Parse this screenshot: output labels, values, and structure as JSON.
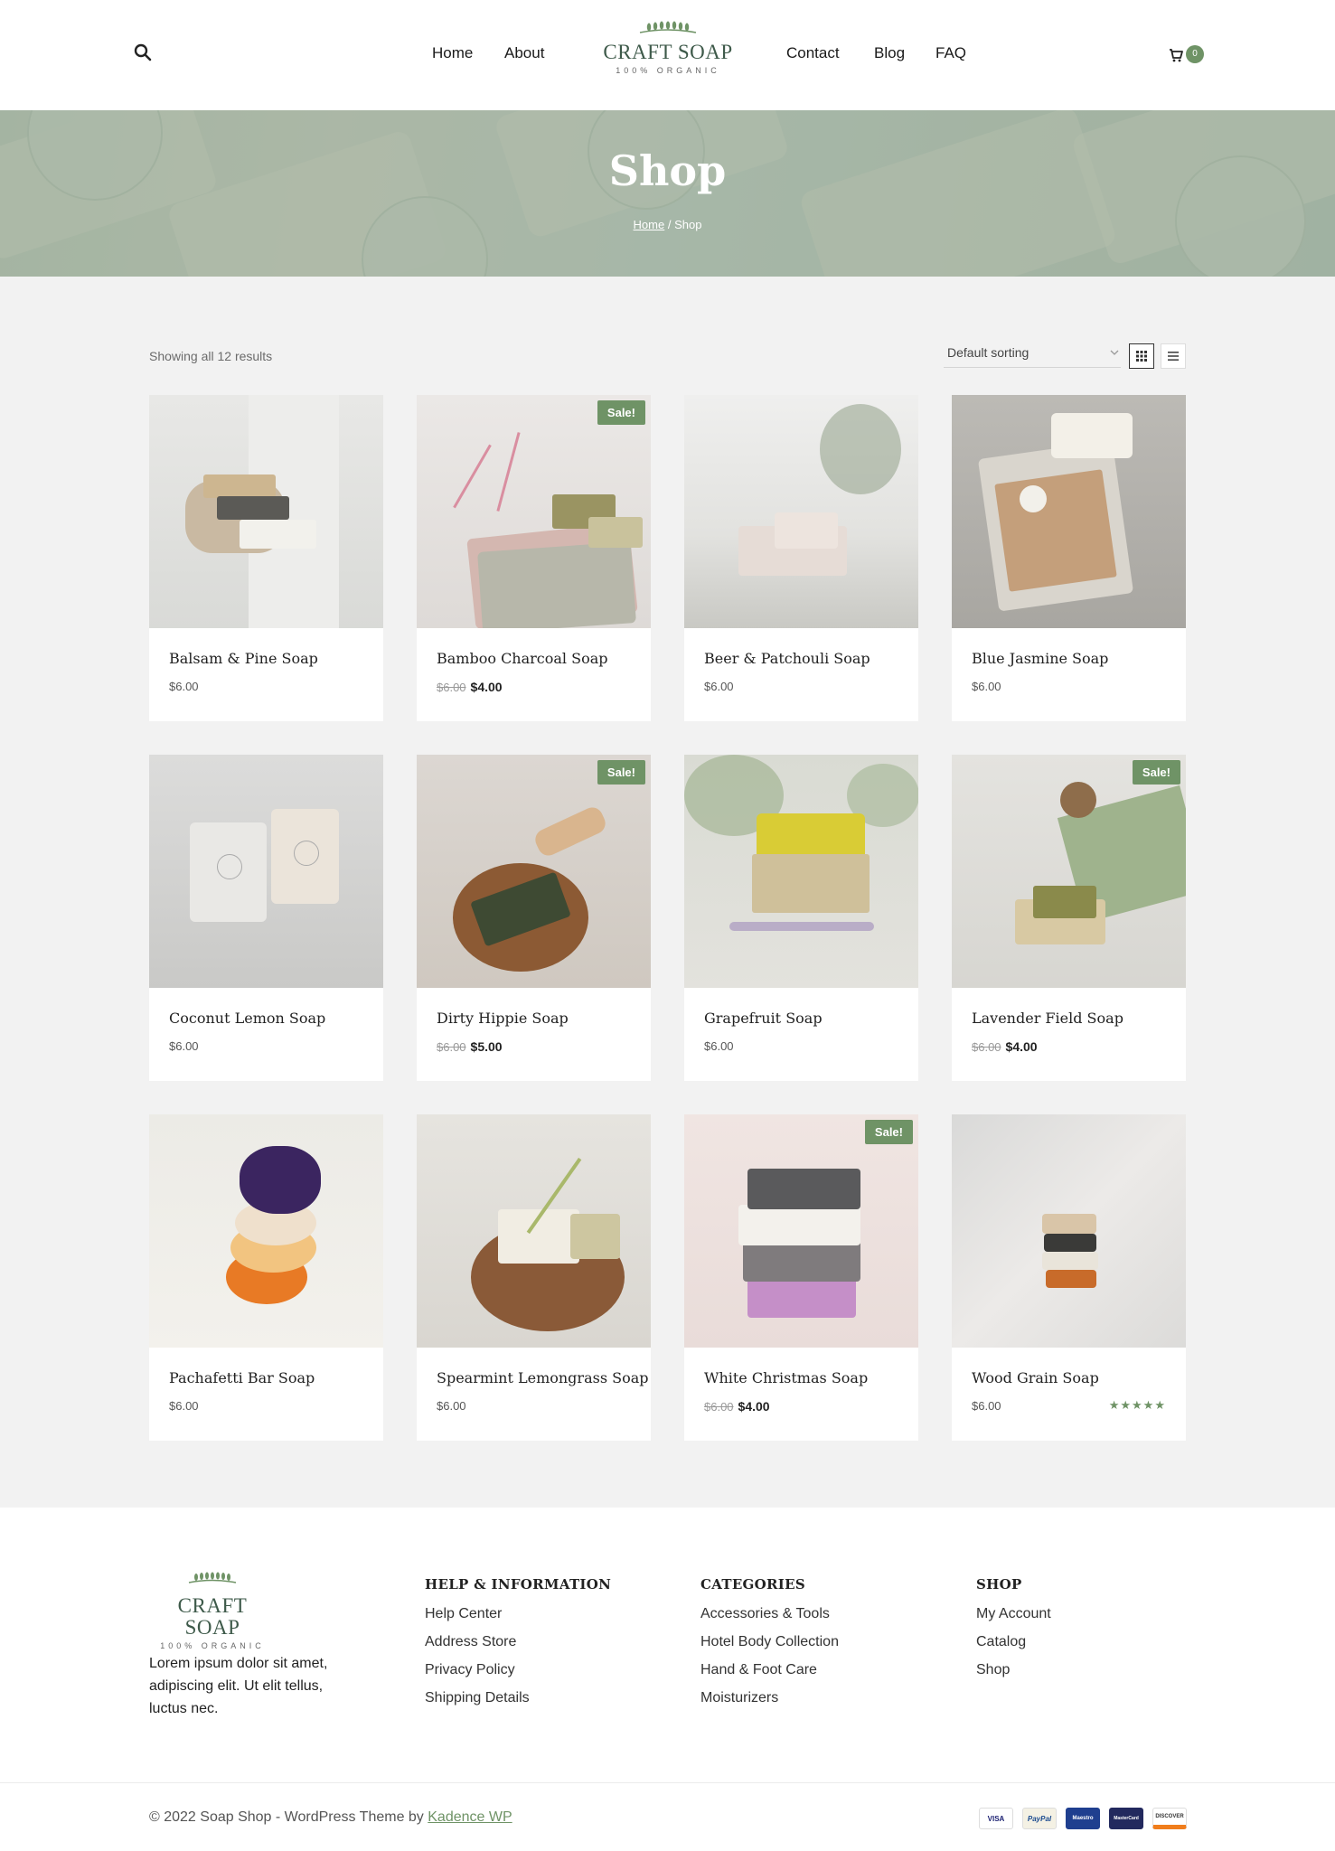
{
  "header": {
    "nav_left": [
      "Home",
      "About"
    ],
    "nav_right": [
      "Contact",
      "Blog",
      "FAQ"
    ],
    "logo_title": "CRAFT SOAP",
    "logo_subtitle": "100% ORGANIC",
    "cart_count": "0"
  },
  "hero": {
    "title": "Shop",
    "breadcrumb_home": "Home",
    "breadcrumb_separator": " / ",
    "breadcrumb_current": "Shop"
  },
  "toolbar": {
    "result_count": "Showing all 12 results",
    "sort_selected": "Default sorting"
  },
  "sale_label": "Sale!",
  "products": [
    {
      "name": "Balsam & Pine Soap",
      "price": "$6.00",
      "old_price": "",
      "sale_price": ""
    },
    {
      "name": "Bamboo Charcoal Soap",
      "price": "",
      "old_price": "$6.00",
      "sale_price": "$4.00"
    },
    {
      "name": "Beer & Patchouli Soap",
      "price": "$6.00",
      "old_price": "",
      "sale_price": ""
    },
    {
      "name": "Blue Jasmine Soap",
      "price": "$6.00",
      "old_price": "",
      "sale_price": ""
    },
    {
      "name": "Coconut Lemon Soap",
      "price": "$6.00",
      "old_price": "",
      "sale_price": ""
    },
    {
      "name": "Dirty Hippie Soap",
      "price": "",
      "old_price": "$6.00",
      "sale_price": "$5.00"
    },
    {
      "name": "Grapefruit Soap",
      "price": "$6.00",
      "old_price": "",
      "sale_price": ""
    },
    {
      "name": "Lavender Field Soap",
      "price": "",
      "old_price": "$6.00",
      "sale_price": "$4.00"
    },
    {
      "name": "Pachafetti Bar Soap",
      "price": "$6.00",
      "old_price": "",
      "sale_price": ""
    },
    {
      "name": "Spearmint Lemongrass Soap",
      "price": "$6.00",
      "old_price": "",
      "sale_price": ""
    },
    {
      "name": "White Christmas Soap",
      "price": "",
      "old_price": "$6.00",
      "sale_price": "$4.00"
    },
    {
      "name": "Wood Grain Soap",
      "price": "$6.00",
      "old_price": "",
      "sale_price": "",
      "rating": 5,
      "rating_stars": "★★★★★"
    }
  ],
  "footer": {
    "logo_title": "CRAFT SOAP",
    "logo_subtitle": "100% ORGANIC",
    "about": "Lorem ipsum dolor sit amet, adipiscing elit. Ut elit tellus, luctus nec.",
    "columns": [
      {
        "heading": "HELP & INFORMATION",
        "items": [
          "Help Center",
          "Address Store",
          "Privacy Policy",
          "Shipping Details"
        ]
      },
      {
        "heading": "CATEGORIES",
        "items": [
          "Accessories & Tools",
          "Hotel Body Collection",
          "Hand & Foot Care",
          "Moisturizers"
        ]
      },
      {
        "heading": "SHOP",
        "items": [
          "My Account",
          "Catalog",
          "Shop"
        ]
      }
    ],
    "copyright": "© 2022 Soap Shop - WordPress Theme by ",
    "copyright_link": "Kadence WP",
    "payments": [
      "VISA",
      "PayPal",
      "Maestro",
      "MasterCard",
      "DISCOVER"
    ]
  },
  "colors": {
    "accent": "#6f9366",
    "logo": "#3e5a4a",
    "page_bg": "#f2f2f2"
  }
}
